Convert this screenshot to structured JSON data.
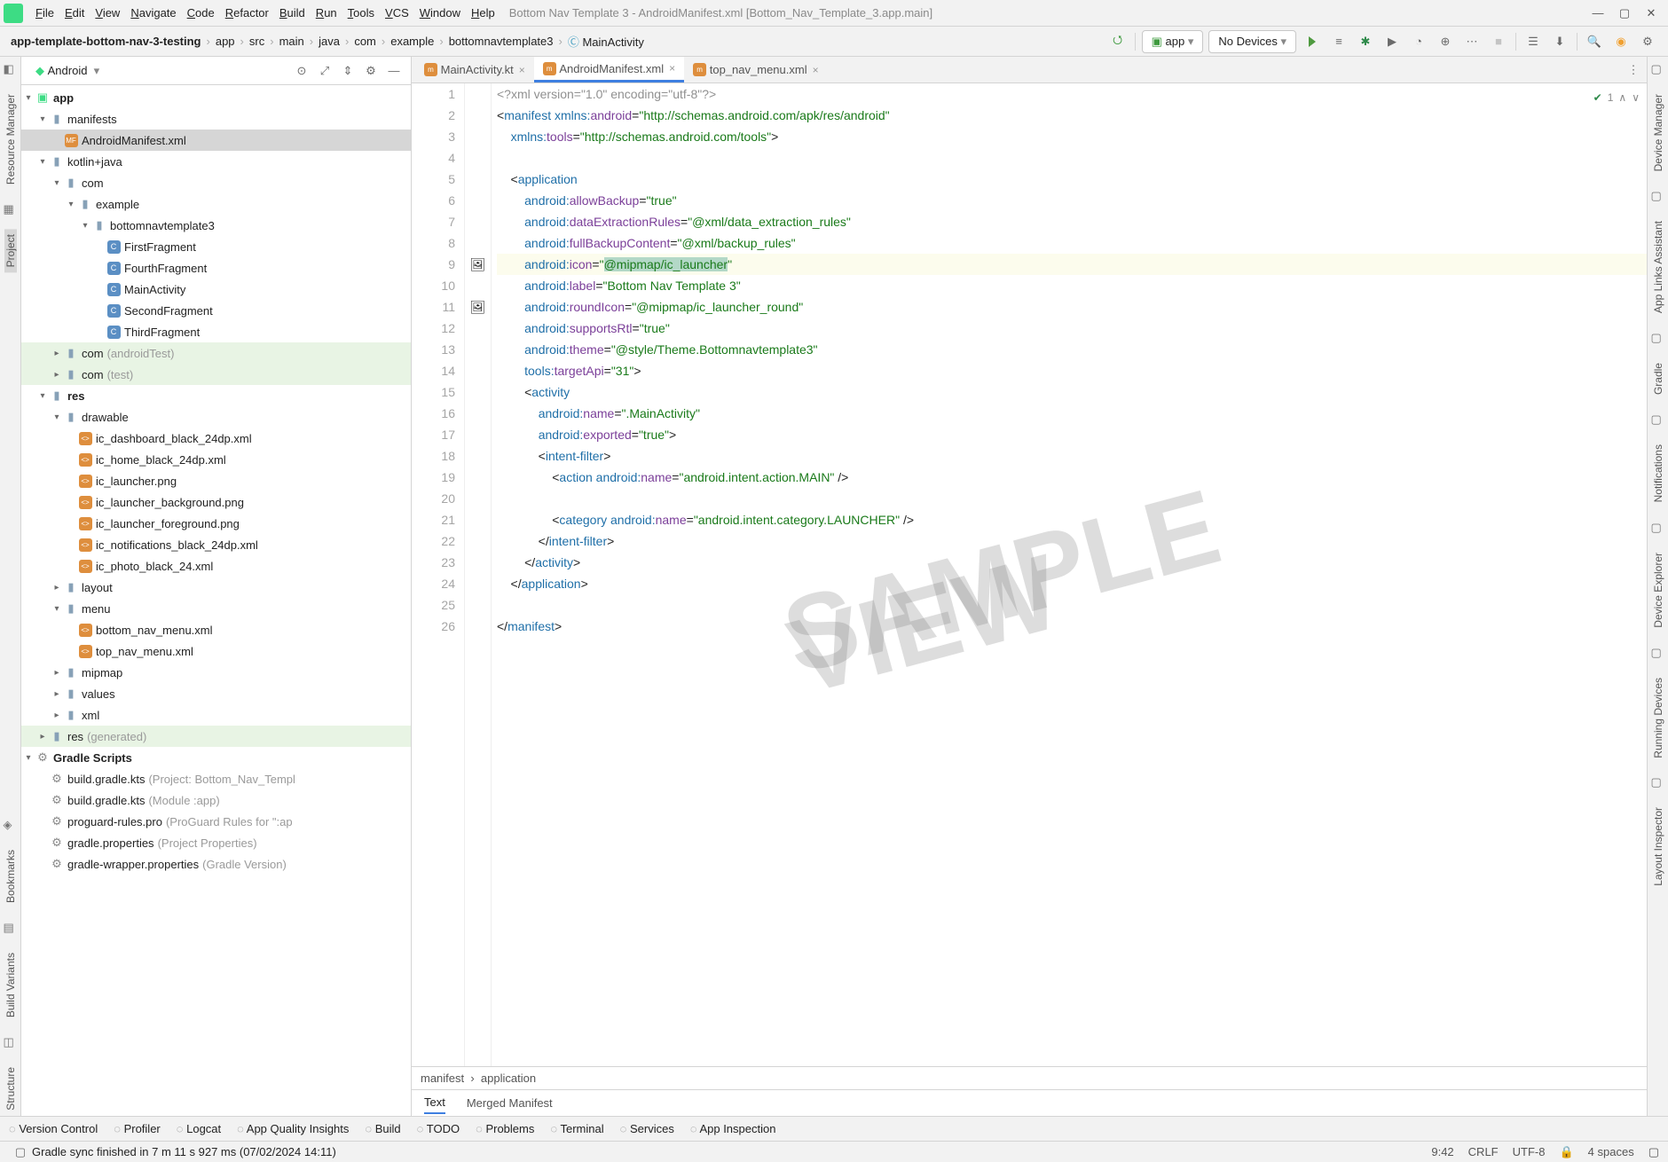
{
  "menu": [
    "File",
    "Edit",
    "View",
    "Navigate",
    "Code",
    "Refactor",
    "Build",
    "Run",
    "Tools",
    "VCS",
    "Window",
    "Help"
  ],
  "windowTitle": "Bottom Nav Template 3 - AndroidManifest.xml [Bottom_Nav_Template_3.app.main]",
  "breadcrumb": [
    "app-template-bottom-nav-3-testing",
    "app",
    "src",
    "main",
    "java",
    "com",
    "example",
    "bottomnavtemplate3",
    "MainActivity"
  ],
  "runConfig": {
    "label": "app"
  },
  "deviceCombo": "No Devices",
  "androidCombo": "Android",
  "tabs": [
    {
      "label": "MainActivity.kt",
      "active": false
    },
    {
      "label": "AndroidManifest.xml",
      "active": true
    },
    {
      "label": "top_nav_menu.xml",
      "active": false
    }
  ],
  "tree": {
    "app": "app",
    "manifests": "manifests",
    "manifestFile": "AndroidManifest.xml",
    "kotlinjava": "kotlin+java",
    "com": "com",
    "example": "example",
    "pkg": "bottomnavtemplate3",
    "classes": [
      "FirstFragment",
      "FourthFragment",
      "MainActivity",
      "SecondFragment",
      "ThirdFragment"
    ],
    "comAndroidTest": {
      "name": "com",
      "note": "(androidTest)"
    },
    "comTest": {
      "name": "com",
      "note": "(test)"
    },
    "res": "res",
    "drawable": "drawable",
    "drawables": [
      "ic_dashboard_black_24dp.xml",
      "ic_home_black_24dp.xml",
      "ic_launcher.png",
      "ic_launcher_background.png",
      "ic_launcher_foreground.png",
      "ic_notifications_black_24dp.xml",
      "ic_photo_black_24.xml"
    ],
    "layout": "layout",
    "menu": "menu",
    "menus": [
      "bottom_nav_menu.xml",
      "top_nav_menu.xml"
    ],
    "mipmap": "mipmap",
    "values_": "values",
    "xml": "xml",
    "resGen": {
      "name": "res",
      "note": "(generated)"
    },
    "gradle": "Gradle Scripts",
    "gradleFiles": [
      {
        "name": "build.gradle.kts",
        "note": "(Project: Bottom_Nav_Templ"
      },
      {
        "name": "build.gradle.kts",
        "note": "(Module :app)"
      },
      {
        "name": "proguard-rules.pro",
        "note": "(ProGuard Rules for \":ap"
      },
      {
        "name": "gradle.properties",
        "note": "(Project Properties)"
      },
      {
        "name": "gradle-wrapper.properties",
        "note": "(Gradle Version)"
      }
    ]
  },
  "leftStrip": [
    "Resource Manager",
    "Project",
    "Bookmarks",
    "Build Variants",
    "Structure"
  ],
  "rightStrip": [
    "Device Manager",
    "App Links Assistant",
    "Gradle",
    "Notifications",
    "Device Explorer",
    "Running Devices",
    "Layout Inspector"
  ],
  "bottomTools": [
    "Version Control",
    "Profiler",
    "Logcat",
    "App Quality Insights",
    "Build",
    "TODO",
    "Problems",
    "Terminal",
    "Services",
    "App Inspection"
  ],
  "breadcrumbBottom": [
    "manifest",
    "application"
  ],
  "subTabs": [
    "Text",
    "Merged Manifest"
  ],
  "status": {
    "msg": "Gradle sync finished in 7 m 11 s 927 ms (07/02/2024 14:11)",
    "pos": "9:42",
    "sep": "CRLF",
    "enc": "UTF-8",
    "indent": "4 spaces"
  },
  "analysis": {
    "count": "1"
  },
  "watermark": "SAMPLE\nVIEW",
  "code": {
    "l1": [
      "<?",
      "xml version=",
      "\"1.0\"",
      " encoding=",
      "\"utf-8\"",
      "?>"
    ],
    "l2": [
      "<",
      "manifest",
      " ",
      "xmlns:",
      "android",
      "=",
      "\"http://schemas.android.com/apk/res/android\""
    ],
    "l3": [
      "    ",
      "xmlns:",
      "tools",
      "=",
      "\"http://schemas.android.com/tools\"",
      ">"
    ],
    "l5": [
      "    <",
      "application"
    ],
    "l6": [
      "        ",
      "android:",
      "allowBackup",
      "=",
      "\"true\""
    ],
    "l7": [
      "        ",
      "android:",
      "dataExtractionRules",
      "=",
      "\"@xml/data_extraction_rules\""
    ],
    "l8": [
      "        ",
      "android:",
      "fullBackupContent",
      "=",
      "\"@xml/backup_rules\""
    ],
    "l9": [
      "        ",
      "android:",
      "icon",
      "=",
      "\"",
      "@mipmap/ic_launcher",
      "\""
    ],
    "l10": [
      "        ",
      "android:",
      "label",
      "=",
      "\"Bottom Nav Template 3\""
    ],
    "l11": [
      "        ",
      "android:",
      "roundIcon",
      "=",
      "\"@mipmap/ic_launcher_round\""
    ],
    "l12": [
      "        ",
      "android:",
      "supportsRtl",
      "=",
      "\"true\""
    ],
    "l13": [
      "        ",
      "android:",
      "theme",
      "=",
      "\"@style/Theme.Bottomnavtemplate3\""
    ],
    "l14": [
      "        ",
      "tools:",
      "targetApi",
      "=",
      "\"31\"",
      ">"
    ],
    "l15": [
      "        <",
      "activity"
    ],
    "l16": [
      "            ",
      "android:",
      "name",
      "=",
      "\".MainActivity\""
    ],
    "l17": [
      "            ",
      "android:",
      "exported",
      "=",
      "\"true\"",
      ">"
    ],
    "l18": [
      "            <",
      "intent-filter",
      ">"
    ],
    "l19": [
      "                <",
      "action",
      " ",
      "android:",
      "name",
      "=",
      "\"android.intent.action.MAIN\"",
      " />"
    ],
    "l21": [
      "                <",
      "category",
      " ",
      "android:",
      "name",
      "=",
      "\"android.intent.category.LAUNCHER\"",
      " />"
    ],
    "l22": [
      "            </",
      "intent-filter",
      ">"
    ],
    "l23": [
      "        </",
      "activity",
      ">"
    ],
    "l24": [
      "    </",
      "application",
      ">"
    ],
    "l26": [
      "</",
      "manifest",
      ">"
    ]
  }
}
